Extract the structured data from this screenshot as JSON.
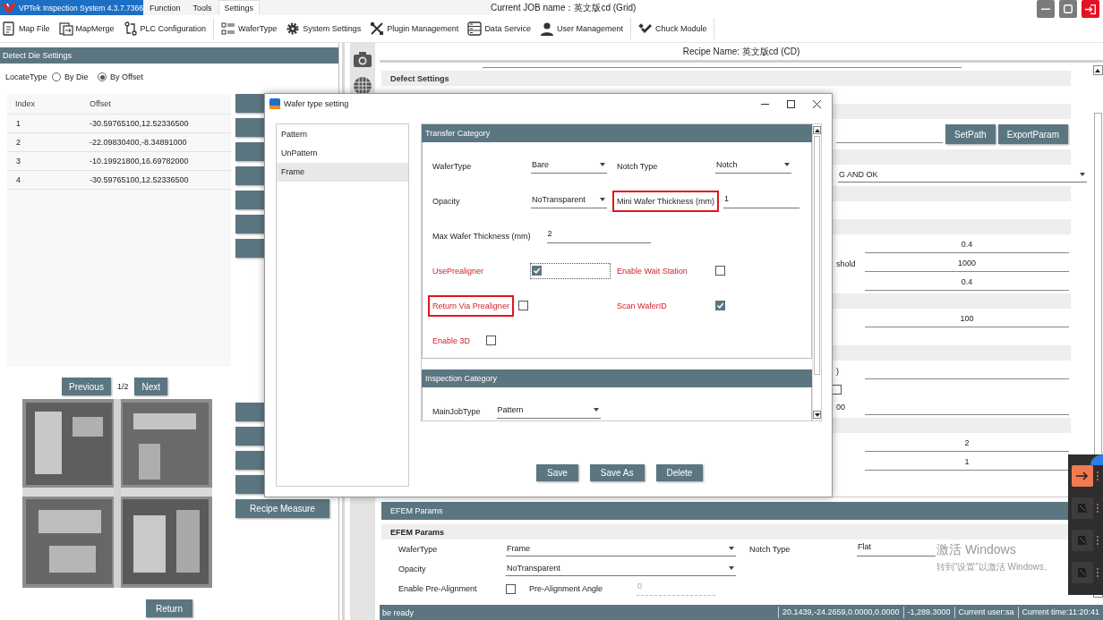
{
  "app": {
    "title": "VPTek Inspection System 4.3.7.7366",
    "menus": [
      {
        "label": "Function",
        "selected": false
      },
      {
        "label": "Tools",
        "selected": false
      },
      {
        "label": "Settings",
        "selected": true
      }
    ],
    "job": "Current JOB name：英文版cd (Grid)"
  },
  "toolbar": [
    [
      "Map File",
      "MapMerge",
      "PLC Configuration"
    ],
    [
      "WaferType",
      "System Settings",
      "Plugin Management",
      "Data Service",
      "User Management"
    ],
    [
      "Chuck Module"
    ]
  ],
  "detect_die": {
    "title": "Detect Die Settings",
    "locate_label": "LocateType",
    "locate_options": [
      {
        "label": "By Die",
        "selected": false
      },
      {
        "label": "By Offset",
        "selected": true
      }
    ],
    "table": {
      "columns": [
        "Index",
        "Offset"
      ],
      "rows": [
        [
          "1",
          "-30.59765100,12.52336500"
        ],
        [
          "2",
          "-22.09830400,-8.34891000"
        ],
        [
          "3",
          "-10.19921800,16.69782000"
        ],
        [
          "4",
          "-30.59765100,12.52336500"
        ]
      ]
    },
    "pager": {
      "previous": "Previous",
      "page": "1/2",
      "next": "Next"
    },
    "recipe_measure": "Recipe Measure",
    "return": "Return"
  },
  "recipe_name": "Recipe Name: 英文版cd (CD)",
  "settings_rows": [
    {
      "kind": "underline"
    },
    {
      "kind": "section",
      "label": "Defect Settings"
    },
    {
      "kind": "blank"
    },
    {
      "kind": "section"
    },
    {
      "kind": "path",
      "buttons": [
        "SetPath",
        "ExportParam"
      ]
    },
    {
      "kind": "section"
    },
    {
      "kind": "dropdown",
      "value": "G AND OK"
    },
    {
      "kind": "section"
    },
    {
      "kind": "blank"
    },
    {
      "kind": "section"
    },
    {
      "kind": "value",
      "value": "0.4"
    },
    {
      "kind": "value",
      "label": "shold",
      "value": "1000"
    },
    {
      "kind": "value",
      "value": "0.4"
    },
    {
      "kind": "section"
    },
    {
      "kind": "value",
      "value": "100"
    },
    {
      "kind": "blank"
    },
    {
      "kind": "section"
    },
    {
      "kind": "value",
      "label": ")"
    },
    {
      "kind": "check",
      "checked": false
    },
    {
      "kind": "value",
      "label": "00"
    },
    {
      "kind": "section"
    },
    {
      "kind": "value",
      "value": "2"
    },
    {
      "kind": "value",
      "value": "1"
    }
  ],
  "efem": {
    "title": "EFEM Params",
    "subtitle": "EFEM Params",
    "rows": [
      [
        {
          "kind": "dropdown",
          "label": "WaferType",
          "value": "Frame"
        },
        {
          "kind": "text",
          "label": "Notch Type",
          "value": "Flat"
        }
      ],
      [
        {
          "kind": "dropdown",
          "label": "Opacity",
          "value": "NoTransparent"
        }
      ],
      [
        {
          "kind": "checkbox",
          "label": "Enable Pre-Alignment",
          "checked": false
        },
        {
          "kind": "text",
          "label": "Pre-Alignment Angle",
          "value": "0",
          "disabled": true
        }
      ]
    ]
  },
  "status": {
    "message": "be ready",
    "fields": [
      "20.1439,-24.2659,0.0000,0.0000",
      "-1,289.3000",
      "Current user:sa",
      "Current time:11:20:41"
    ]
  },
  "wafer_dialog": {
    "title": "Wafer type setting",
    "types": [
      {
        "label": "Pattern",
        "selected": false
      },
      {
        "label": "UnPattern",
        "selected": false
      },
      {
        "label": "Frame",
        "selected": true
      }
    ],
    "transfer": {
      "title": "Transfer Category",
      "rows": [
        [
          {
            "kind": "dropdown",
            "label": "WaferType",
            "value": "Bare"
          },
          {
            "kind": "dropdown",
            "label": "Notch Type",
            "value": "Notch"
          }
        ],
        [
          {
            "kind": "dropdown",
            "label": "Opacity",
            "value": "NoTransparent"
          },
          {
            "kind": "text",
            "label": "Mini Wafer Thickness (mm)",
            "value": "1",
            "highlighted": true
          }
        ],
        [
          {
            "kind": "text",
            "label": "Max Wafer Thickness (mm)",
            "value": "2"
          }
        ],
        [
          {
            "kind": "checkbox",
            "label": "UsePrealigner",
            "checked": true,
            "focused": true
          },
          {
            "kind": "checkbox",
            "label": "Enable Wait Station",
            "checked": false
          }
        ],
        [
          {
            "kind": "checkbox",
            "label": "Return Via Prealigner",
            "checked": false,
            "highlighted": true
          },
          {
            "kind": "checkbox",
            "label": "Scan WaferID",
            "checked": true
          }
        ],
        [
          {
            "kind": "checkbox",
            "label": "Enable 3D",
            "checked": false
          }
        ]
      ]
    },
    "inspection": {
      "title": "Inspection Category",
      "rows": [
        [
          {
            "kind": "dropdown",
            "label": "MainJobType",
            "value": "Pattern"
          }
        ]
      ]
    },
    "buttons": [
      "Save",
      "Save As",
      "Delete"
    ]
  },
  "os_notice": {
    "title": "激活 Windows",
    "hint": "转到“设置”以激活 Windows。"
  }
}
